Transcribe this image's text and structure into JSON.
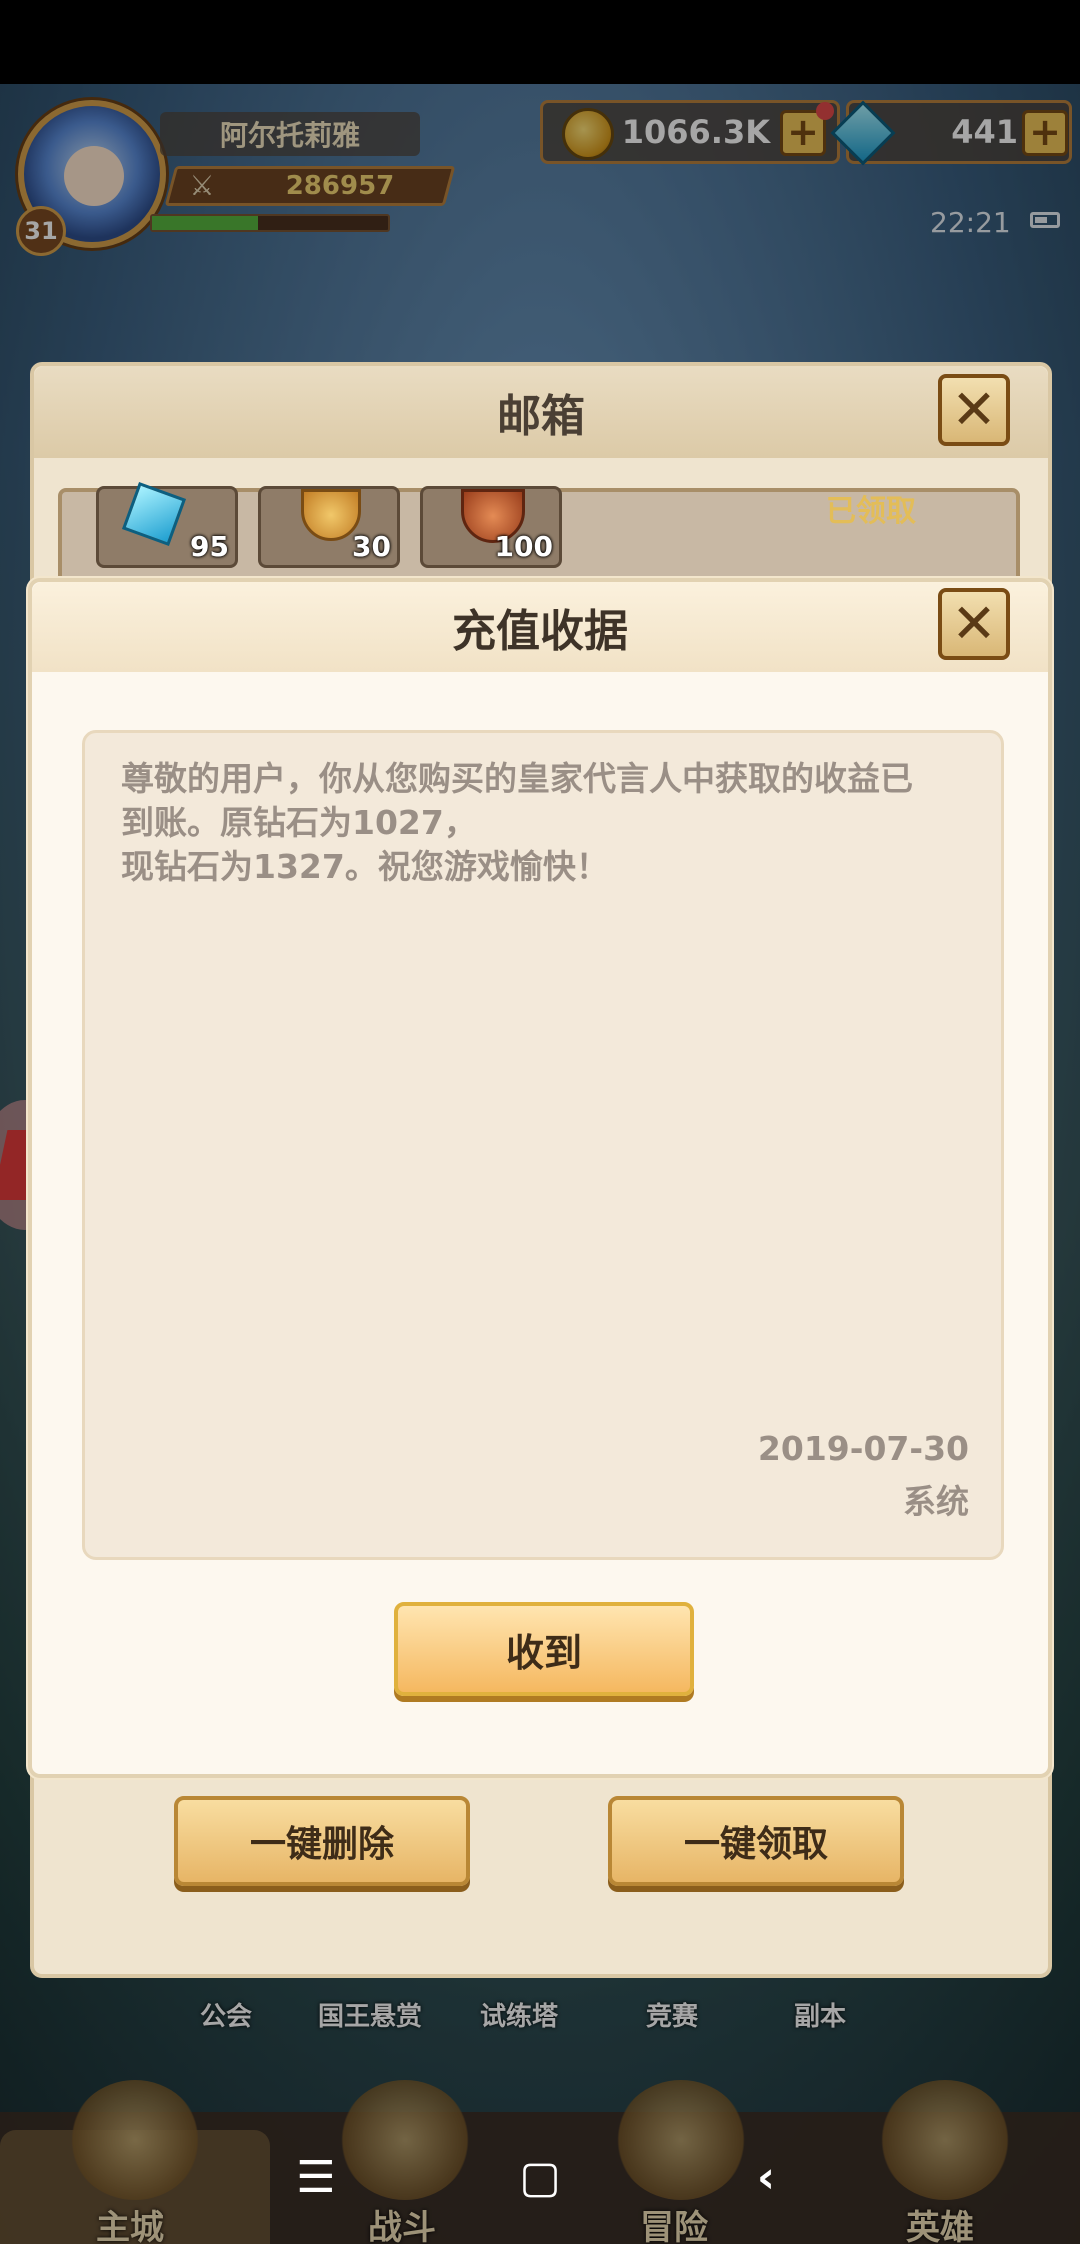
{
  "player": {
    "name": "阿尔托莉雅",
    "level": "31",
    "power": "286957",
    "exp_fraction": 0.45
  },
  "resources": {
    "gold": "1066.3K",
    "diamonds": "441",
    "plus_label": "+"
  },
  "status": {
    "time": "22:21"
  },
  "mailbox": {
    "title": "邮箱",
    "close_label": "✕",
    "items": [
      {
        "icon": "gem-icon",
        "count": "95"
      },
      {
        "icon": "medal-icon",
        "count": "30"
      },
      {
        "icon": "ore-icon",
        "count": "100"
      }
    ],
    "claimed_stamp": "已领取",
    "delete_all_label": "一键删除",
    "claim_all_label": "一键领取"
  },
  "receipt": {
    "title": "充值收据",
    "close_label": "✕",
    "message": "尊敬的用户，你从您购买的皇家代言人中获取的收益已\n到账。原钻石为1027，\n现钻石为1327。祝您游戏愉快！",
    "date": "2019-07-30",
    "sender": "系统",
    "receive_label": "收到"
  },
  "subnav": [
    "公会",
    "国王悬赏",
    "试练塔",
    "竞赛",
    "副本"
  ],
  "bottom_tabs": [
    "主城",
    "战斗",
    "冒险",
    "英雄"
  ],
  "system_nav": {
    "menu_glyph": "☰",
    "home_glyph": "▢",
    "back_glyph": "‹"
  }
}
